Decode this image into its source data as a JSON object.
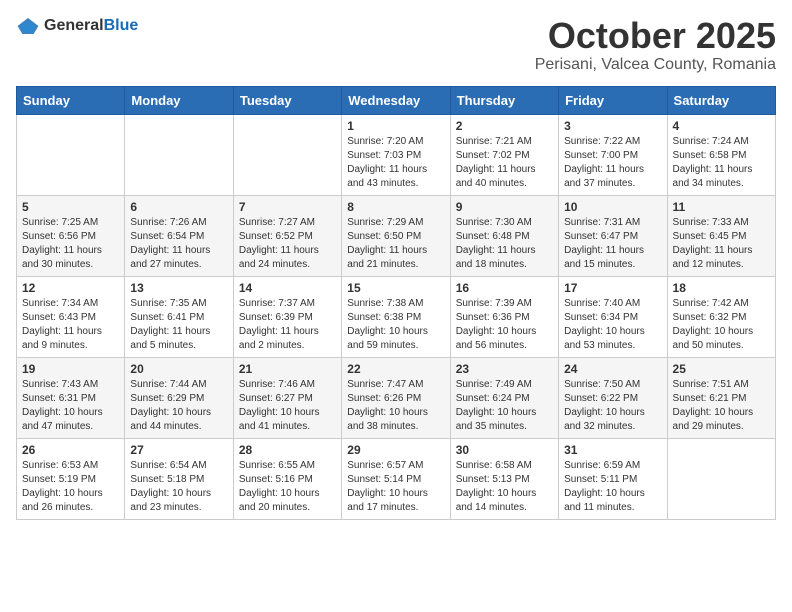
{
  "header": {
    "logo_general": "General",
    "logo_blue": "Blue",
    "month": "October 2025",
    "location": "Perisani, Valcea County, Romania"
  },
  "weekdays": [
    "Sunday",
    "Monday",
    "Tuesday",
    "Wednesday",
    "Thursday",
    "Friday",
    "Saturday"
  ],
  "weeks": [
    [
      {
        "day": "",
        "info": ""
      },
      {
        "day": "",
        "info": ""
      },
      {
        "day": "",
        "info": ""
      },
      {
        "day": "1",
        "info": "Sunrise: 7:20 AM\nSunset: 7:03 PM\nDaylight: 11 hours\nand 43 minutes."
      },
      {
        "day": "2",
        "info": "Sunrise: 7:21 AM\nSunset: 7:02 PM\nDaylight: 11 hours\nand 40 minutes."
      },
      {
        "day": "3",
        "info": "Sunrise: 7:22 AM\nSunset: 7:00 PM\nDaylight: 11 hours\nand 37 minutes."
      },
      {
        "day": "4",
        "info": "Sunrise: 7:24 AM\nSunset: 6:58 PM\nDaylight: 11 hours\nand 34 minutes."
      }
    ],
    [
      {
        "day": "5",
        "info": "Sunrise: 7:25 AM\nSunset: 6:56 PM\nDaylight: 11 hours\nand 30 minutes."
      },
      {
        "day": "6",
        "info": "Sunrise: 7:26 AM\nSunset: 6:54 PM\nDaylight: 11 hours\nand 27 minutes."
      },
      {
        "day": "7",
        "info": "Sunrise: 7:27 AM\nSunset: 6:52 PM\nDaylight: 11 hours\nand 24 minutes."
      },
      {
        "day": "8",
        "info": "Sunrise: 7:29 AM\nSunset: 6:50 PM\nDaylight: 11 hours\nand 21 minutes."
      },
      {
        "day": "9",
        "info": "Sunrise: 7:30 AM\nSunset: 6:48 PM\nDaylight: 11 hours\nand 18 minutes."
      },
      {
        "day": "10",
        "info": "Sunrise: 7:31 AM\nSunset: 6:47 PM\nDaylight: 11 hours\nand 15 minutes."
      },
      {
        "day": "11",
        "info": "Sunrise: 7:33 AM\nSunset: 6:45 PM\nDaylight: 11 hours\nand 12 minutes."
      }
    ],
    [
      {
        "day": "12",
        "info": "Sunrise: 7:34 AM\nSunset: 6:43 PM\nDaylight: 11 hours\nand 9 minutes."
      },
      {
        "day": "13",
        "info": "Sunrise: 7:35 AM\nSunset: 6:41 PM\nDaylight: 11 hours\nand 5 minutes."
      },
      {
        "day": "14",
        "info": "Sunrise: 7:37 AM\nSunset: 6:39 PM\nDaylight: 11 hours\nand 2 minutes."
      },
      {
        "day": "15",
        "info": "Sunrise: 7:38 AM\nSunset: 6:38 PM\nDaylight: 10 hours\nand 59 minutes."
      },
      {
        "day": "16",
        "info": "Sunrise: 7:39 AM\nSunset: 6:36 PM\nDaylight: 10 hours\nand 56 minutes."
      },
      {
        "day": "17",
        "info": "Sunrise: 7:40 AM\nSunset: 6:34 PM\nDaylight: 10 hours\nand 53 minutes."
      },
      {
        "day": "18",
        "info": "Sunrise: 7:42 AM\nSunset: 6:32 PM\nDaylight: 10 hours\nand 50 minutes."
      }
    ],
    [
      {
        "day": "19",
        "info": "Sunrise: 7:43 AM\nSunset: 6:31 PM\nDaylight: 10 hours\nand 47 minutes."
      },
      {
        "day": "20",
        "info": "Sunrise: 7:44 AM\nSunset: 6:29 PM\nDaylight: 10 hours\nand 44 minutes."
      },
      {
        "day": "21",
        "info": "Sunrise: 7:46 AM\nSunset: 6:27 PM\nDaylight: 10 hours\nand 41 minutes."
      },
      {
        "day": "22",
        "info": "Sunrise: 7:47 AM\nSunset: 6:26 PM\nDaylight: 10 hours\nand 38 minutes."
      },
      {
        "day": "23",
        "info": "Sunrise: 7:49 AM\nSunset: 6:24 PM\nDaylight: 10 hours\nand 35 minutes."
      },
      {
        "day": "24",
        "info": "Sunrise: 7:50 AM\nSunset: 6:22 PM\nDaylight: 10 hours\nand 32 minutes."
      },
      {
        "day": "25",
        "info": "Sunrise: 7:51 AM\nSunset: 6:21 PM\nDaylight: 10 hours\nand 29 minutes."
      }
    ],
    [
      {
        "day": "26",
        "info": "Sunrise: 6:53 AM\nSunset: 5:19 PM\nDaylight: 10 hours\nand 26 minutes."
      },
      {
        "day": "27",
        "info": "Sunrise: 6:54 AM\nSunset: 5:18 PM\nDaylight: 10 hours\nand 23 minutes."
      },
      {
        "day": "28",
        "info": "Sunrise: 6:55 AM\nSunset: 5:16 PM\nDaylight: 10 hours\nand 20 minutes."
      },
      {
        "day": "29",
        "info": "Sunrise: 6:57 AM\nSunset: 5:14 PM\nDaylight: 10 hours\nand 17 minutes."
      },
      {
        "day": "30",
        "info": "Sunrise: 6:58 AM\nSunset: 5:13 PM\nDaylight: 10 hours\nand 14 minutes."
      },
      {
        "day": "31",
        "info": "Sunrise: 6:59 AM\nSunset: 5:11 PM\nDaylight: 10 hours\nand 11 minutes."
      },
      {
        "day": "",
        "info": ""
      }
    ]
  ]
}
